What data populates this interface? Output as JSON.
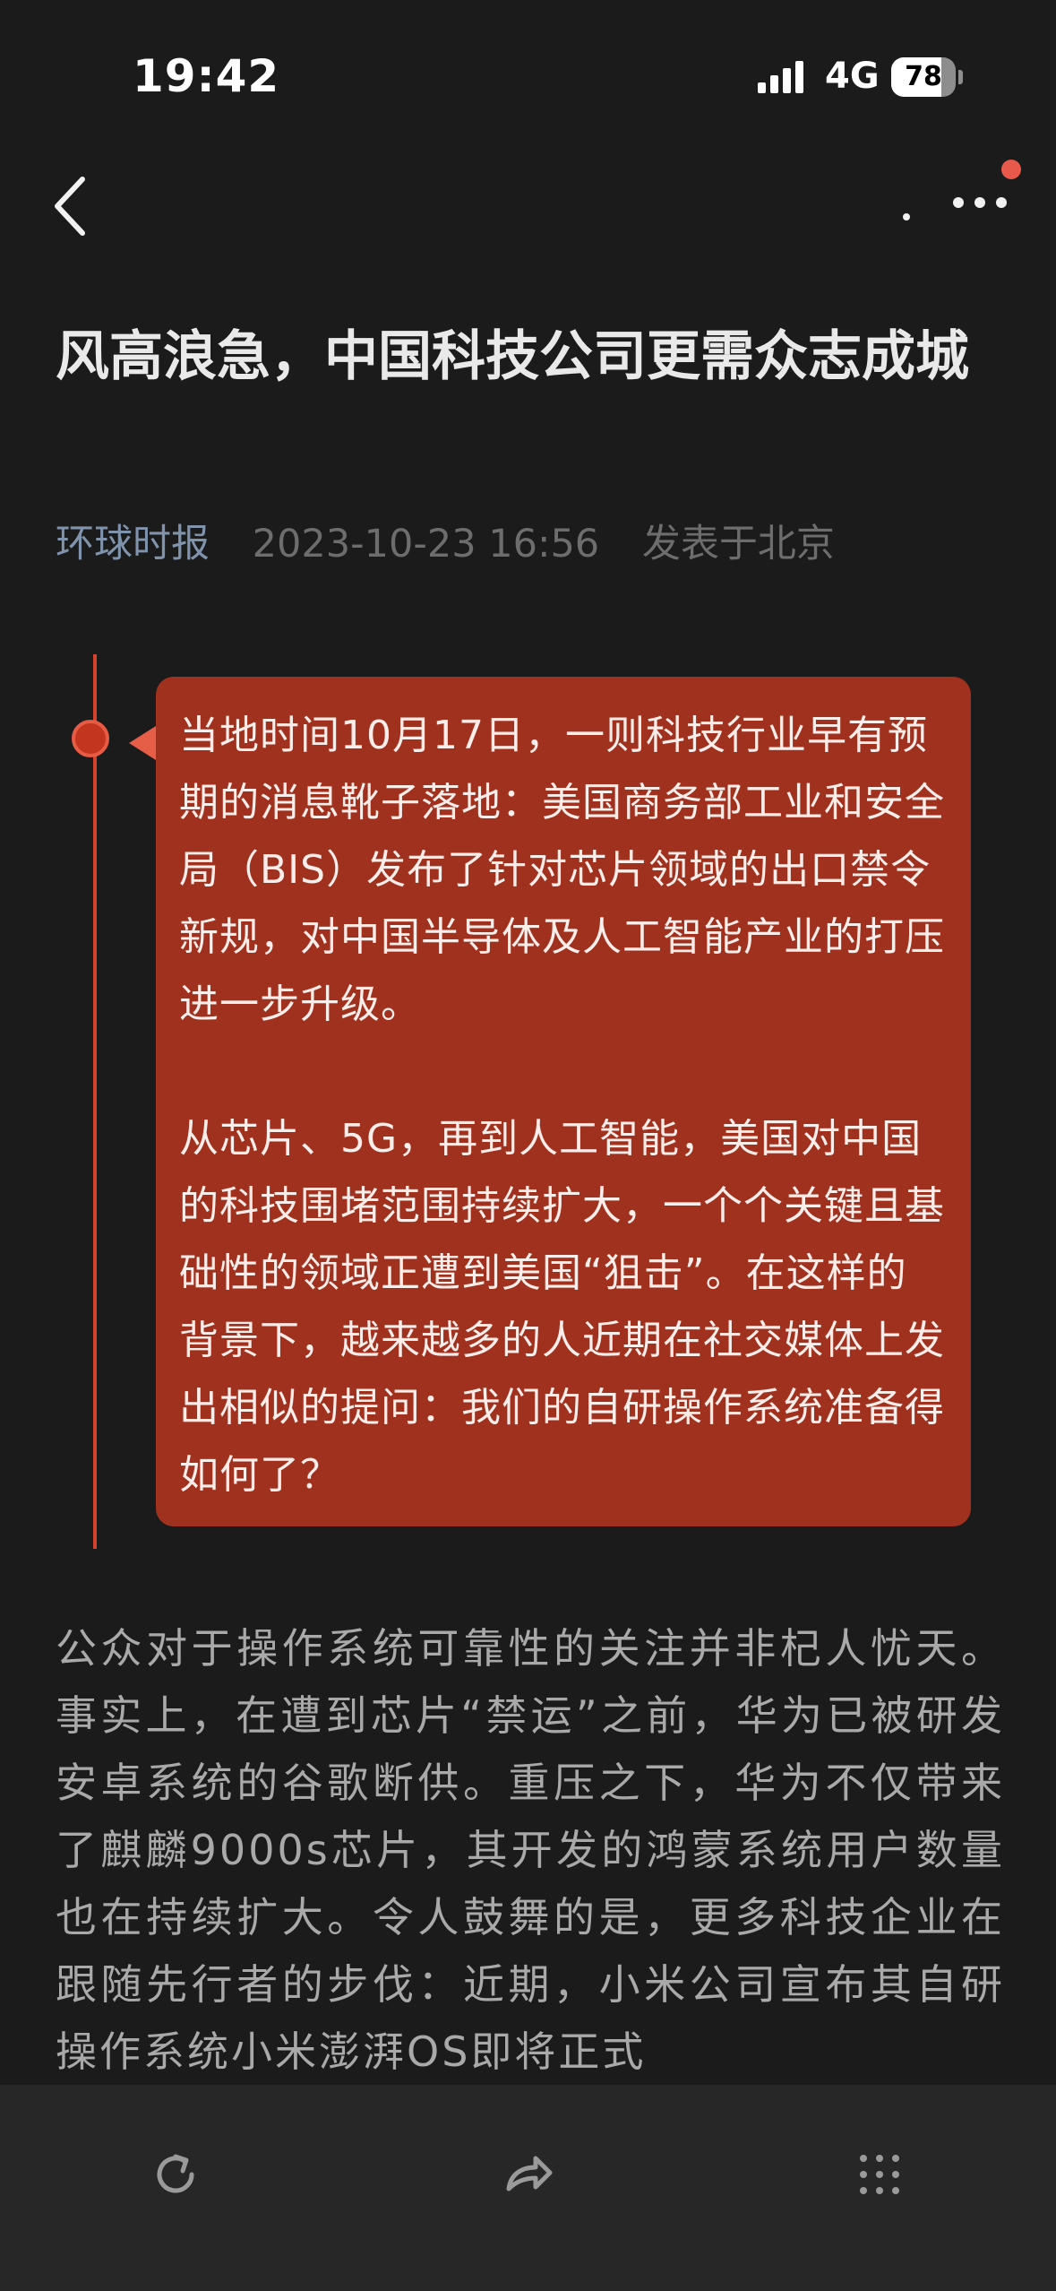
{
  "status_bar": {
    "time": "19:42",
    "network": "4G",
    "battery": "78",
    "battery_level": 0.78
  },
  "nav": {
    "back_icon": "chevron-left-icon",
    "more_icon": "more-dots-icon",
    "has_notification": true
  },
  "article": {
    "title": "风高浪急，中国科技公司更需众志成城",
    "source": "环球时报",
    "date": "2023-10-23 16:56",
    "location": "发表于北京",
    "highlight_paragraphs": [
      "当地时间10月17日，一则科技行业早有预期的消息靴子落地：美国商务部工业和安全局（BIS）发布了针对芯片领域的出口禁令新规，对中国半导体及人工智能产业的打压进一步升级。",
      "从芯片、5G，再到人工智能，美国对中国的科技围堵范围持续扩大，一个个关键且基础性的领域正遭到美国“狙击”。在这样的背景下，越来越多的人近期在社交媒体上发出相似的提问：我们的自研操作系统准备得如何了？"
    ],
    "body": "公众对于操作系统可靠性的关注并非杞人忧天。事实上，在遭到芯片“禁运”之前，华为已被研发安卓系统的谷歌断供。重压之下，华为不仅带来了麒麟9000s芯片，其开发的鸿蒙系统用户数量也在持续扩大。令人鼓舞的是，更多科技企业在跟随先行者的步伐：近期，小米公司宣布其自研操作系统小米澎湃OS即将正式"
  },
  "toolbar": {
    "icons": [
      "refresh-icon",
      "share-icon",
      "grid-menu-icon"
    ]
  },
  "colors": {
    "background": "#1b1b1b",
    "highlight_bubble": "#a1311f",
    "accent": "#d5432f",
    "source_link": "#7f93ad"
  }
}
